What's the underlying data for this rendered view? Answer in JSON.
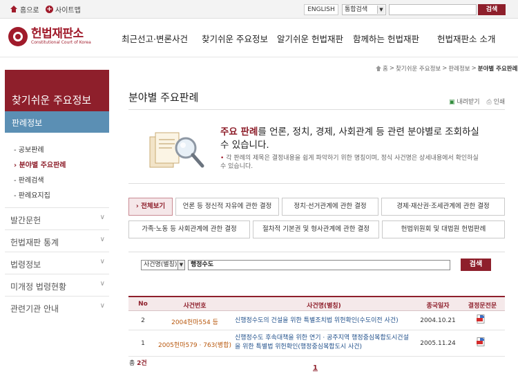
{
  "topbar": {
    "home_label": "홈으로",
    "sitemap_label": "사이트맵",
    "english_label": "ENGLISH",
    "search_scope": "통합검색",
    "search_button": "검색"
  },
  "header": {
    "logo_main": "헌법재판소",
    "logo_sub": "Constitutional Court of Korea",
    "nav": [
      "최근선고·변론사건",
      "찾기쉬운 주요정보",
      "알기쉬운 헌법재판",
      "함께하는 헌법재판",
      "헌법재판소 소개"
    ]
  },
  "sidebar": {
    "title": "찾기쉬운 주요정보",
    "section": "판례정보",
    "items": [
      "공보판례",
      "분야별 주요판례",
      "판례검색",
      "판례요지집"
    ],
    "menus": [
      "발간문헌",
      "헌법재판 통계",
      "법령정보",
      "미개정 법령현황",
      "관련기관 안내"
    ]
  },
  "breadcrumb": {
    "home": "홈",
    "path1": "찾기쉬운 주요정보",
    "path2": "판례정보",
    "current": "분야별 주요판례",
    "sep": ">"
  },
  "page": {
    "title": "분야별 주요판례",
    "download": "내려받기",
    "print": "인쇄"
  },
  "intro": {
    "head_bold": "주요 판례",
    "head_rest": "를 언론, 정치, 경제, 사회관계 등 관련 분야별로 조회하실 수 있습니다.",
    "note": "각 판례의 제목은 결정내용을 쉽게 파악하기 위한 명칭이며, 정식 사건명은 상세내용에서 확인하실 수 있습니다."
  },
  "categories": [
    "전체보기",
    "언론 등 정신적 자유에 관한 결정",
    "정치·선거관계에 관한 결정",
    "경제·재산권·조세관계에 관한 결정",
    "가족·노동 등 사회관계에 관한 결정",
    "절차적 기본권 및 형사관계에 관한 결정",
    "헌법위원회 및 대법원 헌법판례"
  ],
  "search": {
    "field": "사건명(별칭)",
    "value": "행정수도",
    "button": "검색"
  },
  "table": {
    "headers": [
      "No",
      "사건번호",
      "사건명(별칭)",
      "종국일자",
      "결정문전문"
    ],
    "rows": [
      {
        "no": "2",
        "case_no": "2004헌마554 등",
        "name": "신행정수도의 건설을 위한 특별조치법 위헌확인(수도이전 사건)",
        "date": "2004.10.21"
      },
      {
        "no": "1",
        "case_no": "2005헌마579 · 763(병합)",
        "name": "신행정수도 후속대책을 위한 연기 · 공주지역 행정중심복합도시건설을 위한 특별법 위헌확인(행정중심복합도시 사건)",
        "date": "2005.11.24"
      }
    ]
  },
  "footer": {
    "total_prefix": "총",
    "total_count": "2건",
    "current_page": "1"
  },
  "colors": {
    "brand": "#8e1f2b",
    "side_section": "#5b8fb4",
    "case_no": "#b8580e",
    "case_name": "#1f4f8a"
  }
}
